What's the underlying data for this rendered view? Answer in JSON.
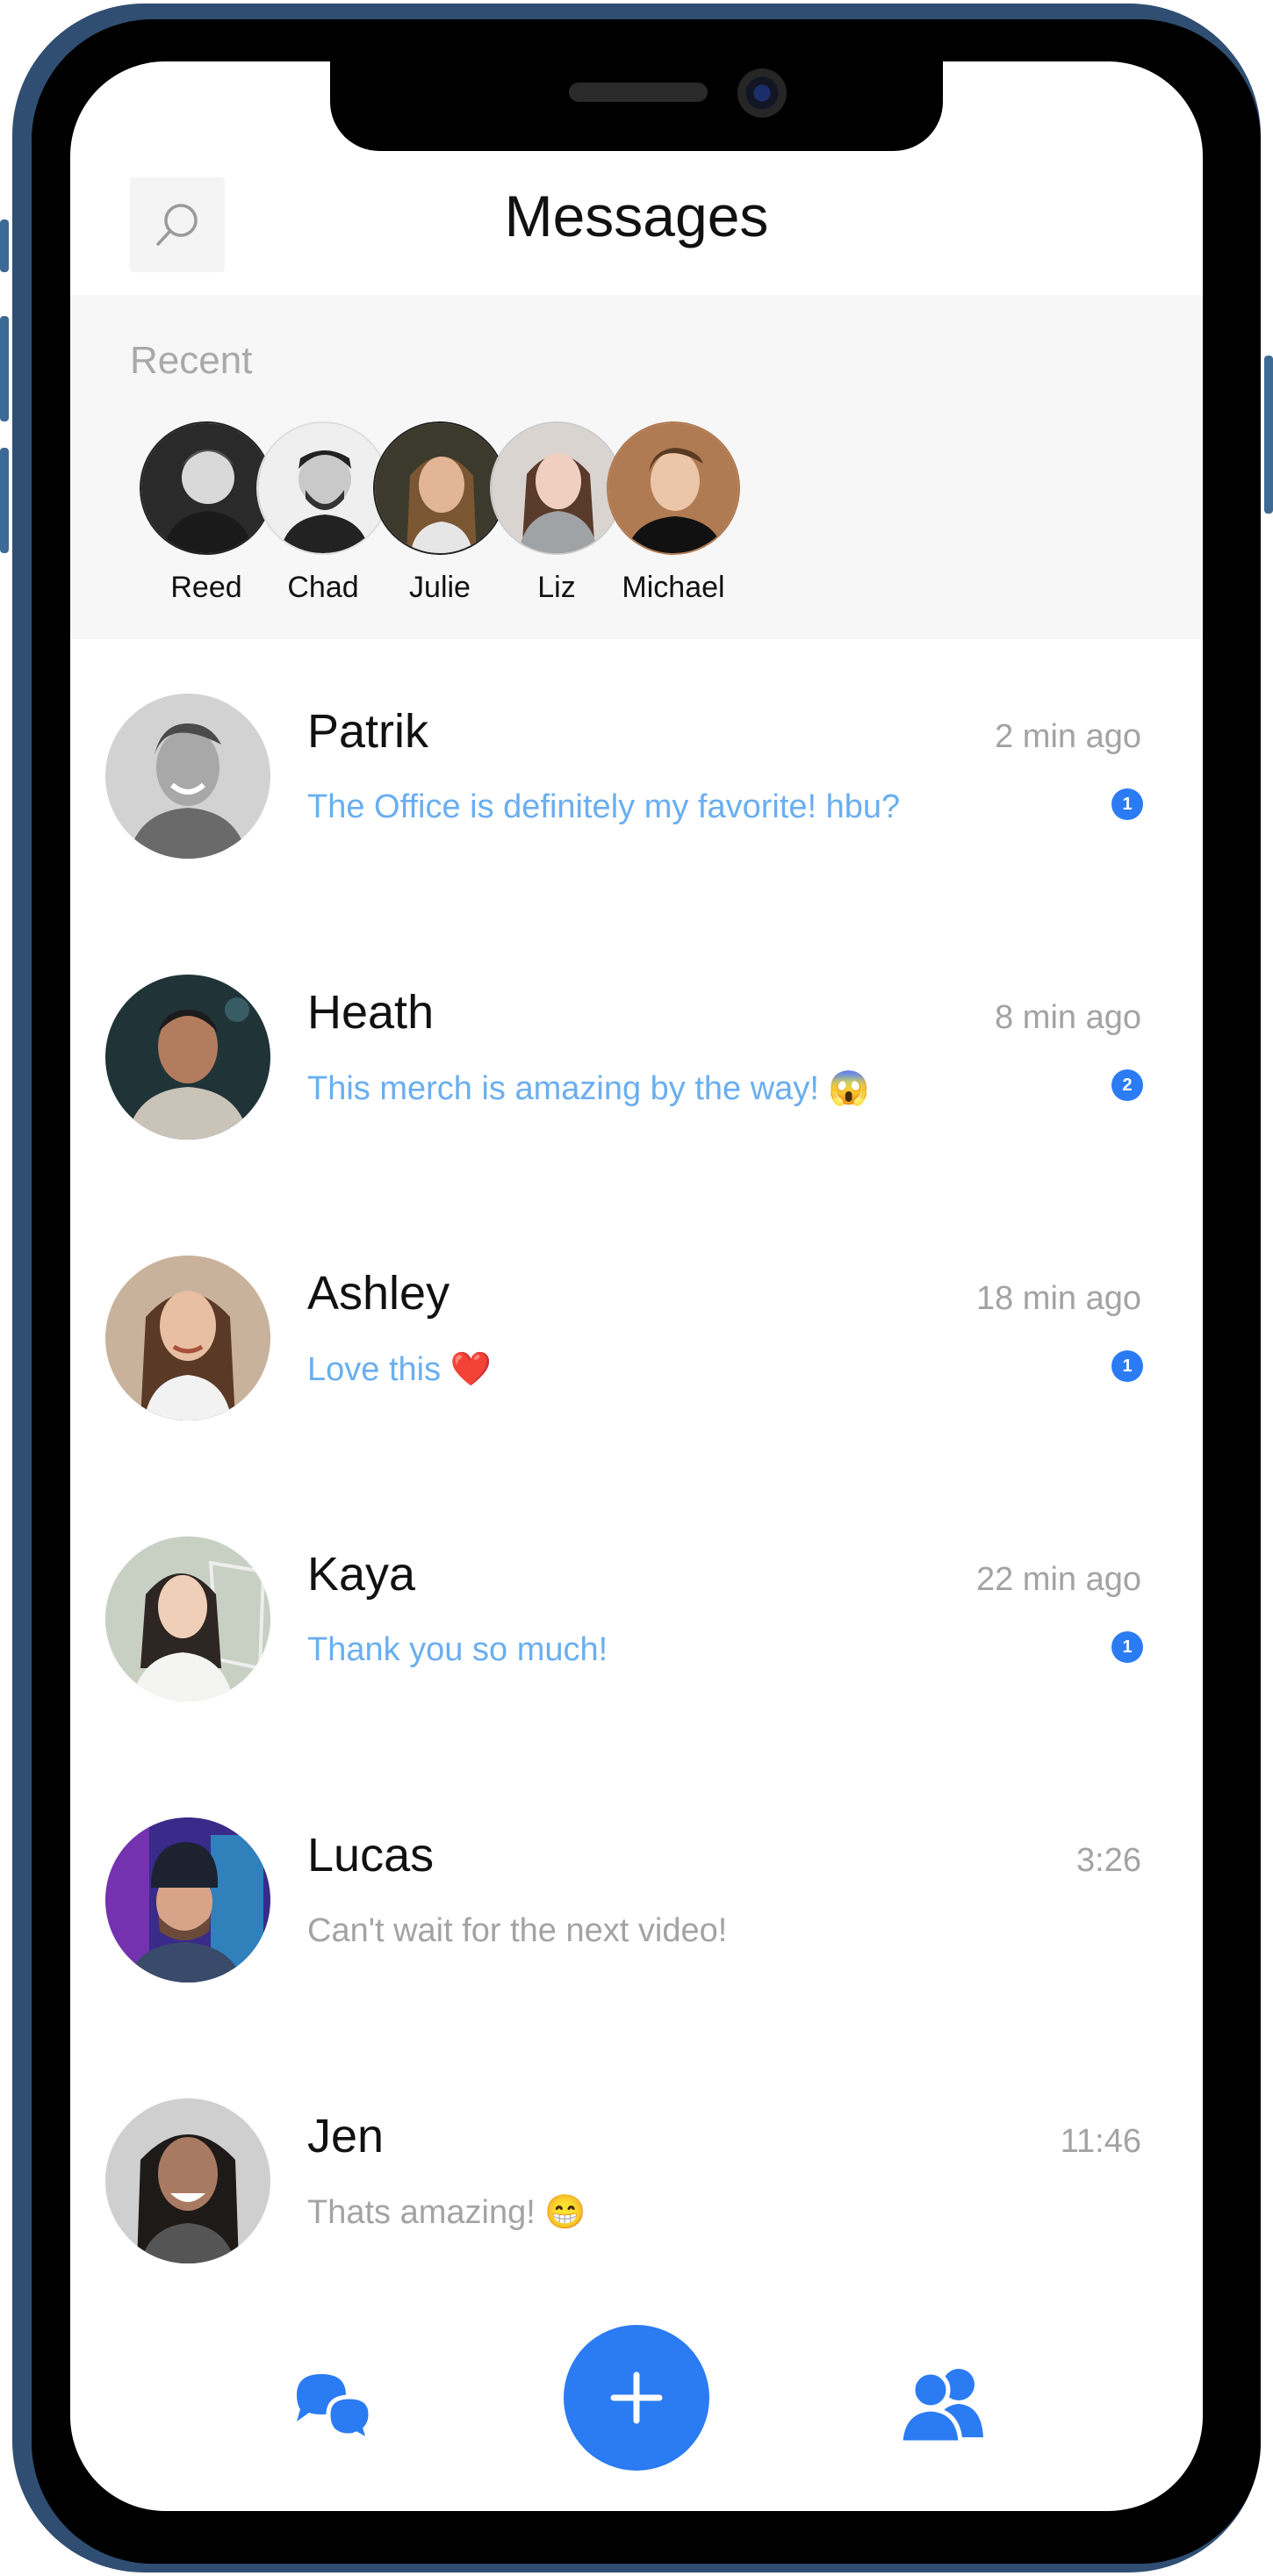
{
  "header": {
    "title": "Messages"
  },
  "recent": {
    "label": "Recent",
    "items": [
      {
        "name": "Reed"
      },
      {
        "name": "Chad"
      },
      {
        "name": "Julie"
      },
      {
        "name": "Liz"
      },
      {
        "name": "Michael"
      }
    ]
  },
  "conversations": [
    {
      "name": "Patrik",
      "time": "2 min ago",
      "message": "The Office is definitely my favorite! hbu?",
      "unread": "1"
    },
    {
      "name": "Heath",
      "time": "8 min ago",
      "message": "This merch is amazing by the way! 😱",
      "unread": "2"
    },
    {
      "name": "Ashley",
      "time": "18 min ago",
      "message": "Love this ❤️",
      "unread": "1"
    },
    {
      "name": "Kaya",
      "time": "22 min ago",
      "message": "Thank you so much!",
      "unread": "1"
    },
    {
      "name": "Lucas",
      "time": "3:26",
      "message": "Can't wait for the next video!"
    },
    {
      "name": "Jen",
      "time": "11:46",
      "message": "Thats amazing! 😁"
    }
  ],
  "nav": {
    "chats_icon": "chat-bubbles-icon",
    "compose_icon": "plus-icon",
    "contacts_icon": "contacts-icon"
  },
  "colors": {
    "accent": "#2b7bf2",
    "unread_text": "#6aaef0",
    "read_text": "#a3a3a3",
    "frame": "#2f4e72"
  }
}
